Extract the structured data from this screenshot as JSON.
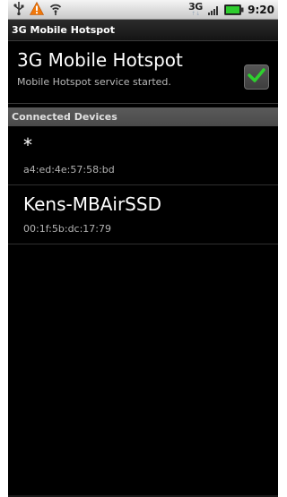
{
  "status_bar": {
    "network_type": "3G",
    "network_arrows": "↑↓",
    "clock": "9:20",
    "icons": [
      "usb-icon",
      "warning-icon",
      "wifi-hotspot-icon",
      "signal-strength-icon",
      "battery-icon"
    ]
  },
  "title_bar": {
    "title": "3G Mobile Hotspot"
  },
  "hotspot_setting": {
    "title": "3G Mobile Hotspot",
    "summary": "Mobile Hotspot service started.",
    "checked": true
  },
  "connected_devices": {
    "header": "Connected Devices",
    "devices": [
      {
        "name": "*",
        "mac": "a4:ed:4e:57:58:bd"
      },
      {
        "name": "Kens-MBAirSSD",
        "mac": "00:1f:5b:dc:17:79"
      }
    ]
  },
  "colors": {
    "background": "#000000",
    "check_green": "#2ed02e",
    "warning_orange": "#f0780a",
    "battery_green": "#2ecc2e"
  }
}
